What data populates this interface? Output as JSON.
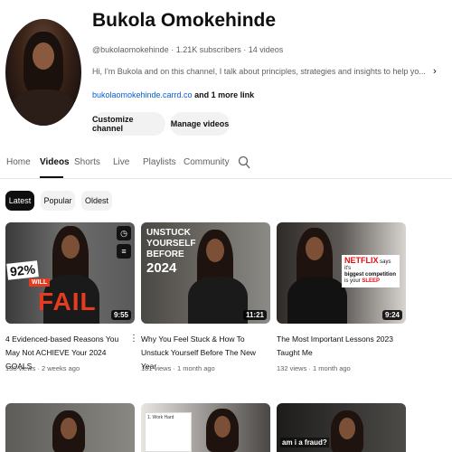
{
  "channel": {
    "name": "Bukola Omokehinde",
    "handle_line": "@bukolaomokehinde · 1.21K subscribers · 14 videos",
    "description": "Hi, I'm Bukola and on this channel, I talk about principles, strategies and insights to help yo...",
    "link": "bukolaomokehinde.carrd.co",
    "more_links": " and 1 more link",
    "buttons": {
      "customize": "Customize channel",
      "manage": "Manage videos"
    }
  },
  "tabs": [
    {
      "label": "Home",
      "active": false
    },
    {
      "label": "Videos",
      "active": true
    },
    {
      "label": "Shorts",
      "active": false
    },
    {
      "label": "Live",
      "active": false
    },
    {
      "label": "Playlists",
      "active": false
    },
    {
      "label": "Community",
      "active": false
    }
  ],
  "chips": {
    "latest": "Latest",
    "popular": "Popular",
    "oldest": "Oldest"
  },
  "videos": [
    {
      "title": "4 Evidenced-based Reasons You May Not ACHIEVE Your 2024 GOALS",
      "stats": "138 views · 2 weeks ago",
      "duration": "9:55",
      "overlay": {
        "percent": "92%",
        "will": "WILL",
        "fail": "FAIL"
      }
    },
    {
      "title": "Why You Feel Stuck & How To Unstuck Yourself Before The New Year",
      "stats": "181 views · 1 month ago",
      "duration": "11:21",
      "overlay": {
        "line1": "UNSTUCK",
        "line2": "YOURSELF",
        "line3": "BEFORE",
        "line4": "2024"
      }
    },
    {
      "title": "The Most Important Lessons 2023 Taught Me",
      "stats": "132 views · 1 month ago",
      "duration": "9:24",
      "overlay": {
        "brand": "NETFLIX",
        "says": "says it's",
        "line": "biggest competition",
        "is": "is your",
        "sleep": "SLEEP"
      }
    }
  ],
  "row2": {
    "card2_text": "1. Work Hard",
    "card3_text": "am i a fraud?"
  },
  "colors": {
    "accent_link": "#065fd4",
    "netflix_red": "#e50914",
    "fail_red": "#e63b1e"
  },
  "icons": [
    "search-icon",
    "clock-icon",
    "playlist-add-icon",
    "kebab-menu-icon",
    "chevron-right-icon"
  ]
}
